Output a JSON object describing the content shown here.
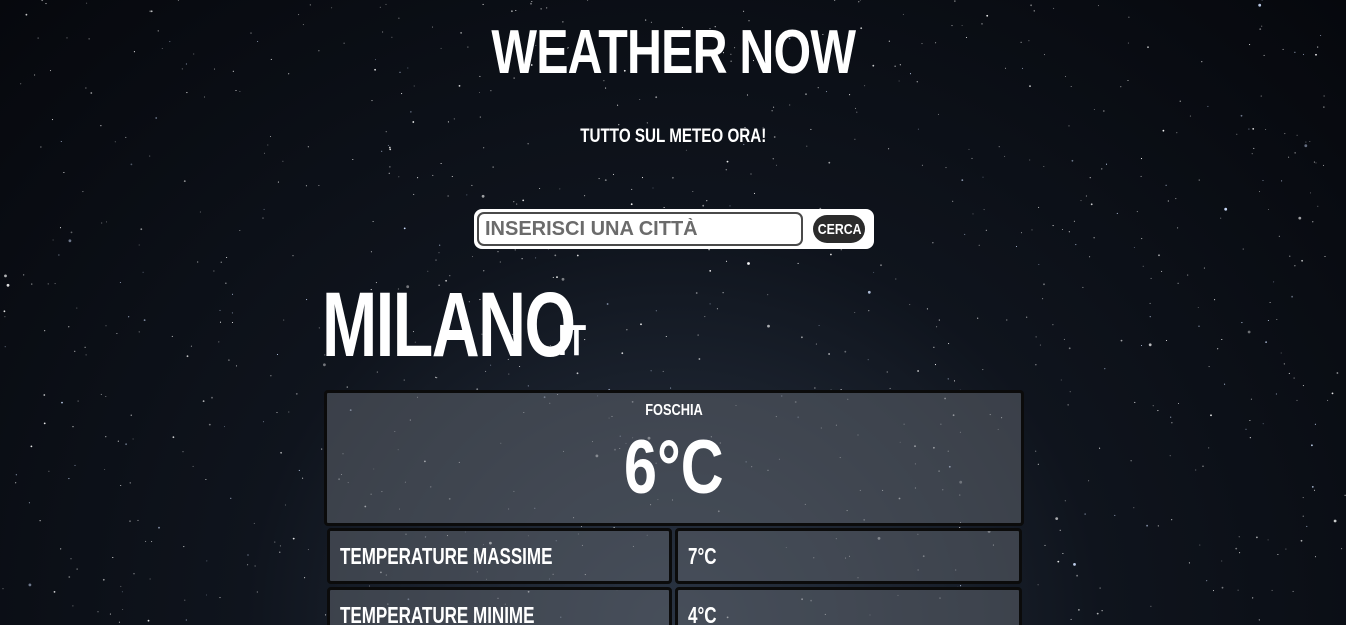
{
  "header": {
    "title": "WEATHER NOW",
    "subtitle": "TUTTO SUL METEO ORA!"
  },
  "search": {
    "placeholder": "INSERISCI UNA CITTÀ",
    "value": "",
    "button_label": "CERCA"
  },
  "location": {
    "city": "MILANO",
    "country": "IT"
  },
  "current": {
    "condition": "FOSCHIA",
    "temperature": "6°C"
  },
  "details": [
    {
      "label": "TEMPERATURE MASSIME",
      "value": "7°C"
    },
    {
      "label": "TEMPERATURE MINIME",
      "value": "4°C"
    }
  ]
}
